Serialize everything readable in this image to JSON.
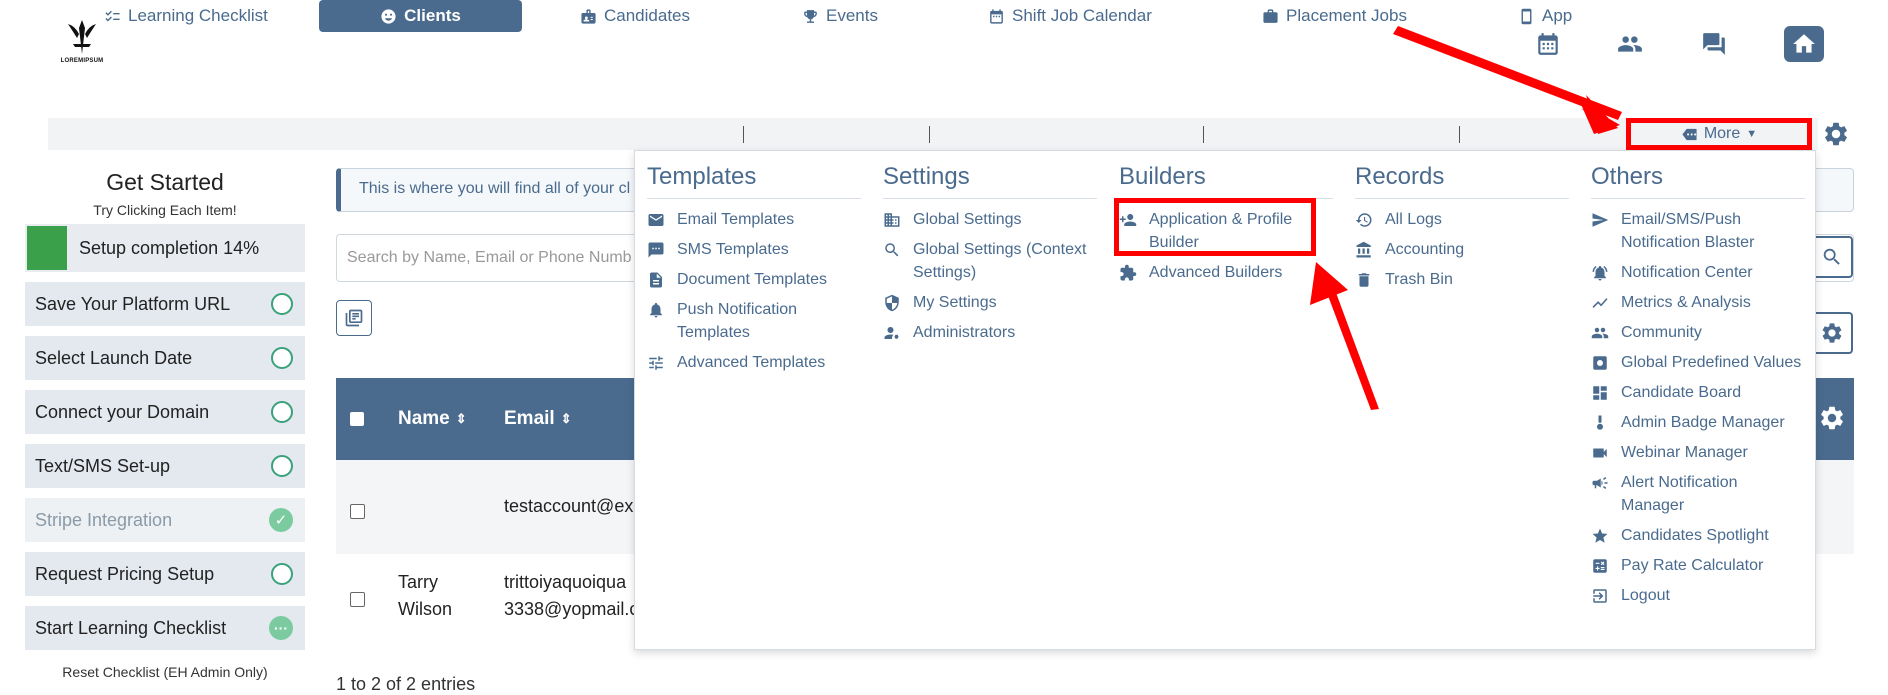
{
  "logo": {
    "text": "LOREMIPSUM"
  },
  "header_icons": [
    "calendar-icon",
    "people-icon",
    "chat-icon",
    "home-icon"
  ],
  "nav": {
    "items": [
      {
        "label": "Learning Checklist",
        "icon": "checklist-icon"
      },
      {
        "label": "Clients",
        "icon": "smile-icon",
        "active": true
      },
      {
        "label": "Candidates",
        "icon": "id-card-icon"
      },
      {
        "label": "Events",
        "icon": "trophy-icon"
      },
      {
        "label": "Shift Job Calendar",
        "icon": "calendar-icon"
      },
      {
        "label": "Placement Jobs",
        "icon": "briefcase-icon"
      },
      {
        "label": "App",
        "icon": "phone-icon"
      }
    ],
    "more_label": "More"
  },
  "checklist": {
    "title": "Get Started",
    "subtitle": "Try Clicking Each Item!",
    "progress_label": "Setup completion 14%",
    "progress_percent": 14,
    "items": [
      {
        "label": "Save Your Platform URL",
        "state": "open"
      },
      {
        "label": "Select Launch Date",
        "state": "open"
      },
      {
        "label": "Connect your Domain",
        "state": "open"
      },
      {
        "label": "Text/SMS Set-up",
        "state": "open"
      },
      {
        "label": "Stripe Integration",
        "state": "done"
      },
      {
        "label": "Request Pricing Setup",
        "state": "open"
      },
      {
        "label": "Start Learning Checklist",
        "state": "in-progress"
      }
    ],
    "reset_label": "Reset Checklist (EH Admin Only)"
  },
  "main": {
    "info_text": "This is where you will find all of your cl",
    "search_placeholder": "Search by Name, Email or Phone Numb",
    "columns": [
      "Name",
      "Email"
    ],
    "rows": [
      {
        "name": "",
        "email": "testaccount@ex"
      },
      {
        "name_line1": "Tarry",
        "name_line2": "Wilson",
        "email_line1": "trittoiyaquoiqua",
        "email_line2": "3338@yopmail.c"
      }
    ],
    "entries_text": "1 to 2 of 2 entries"
  },
  "dropdown": {
    "templates": {
      "heading": "Templates",
      "items": [
        "Email Templates",
        "SMS Templates",
        "Document Templates",
        "Push Notification Templates",
        "Advanced Templates"
      ]
    },
    "settings": {
      "heading": "Settings",
      "items": [
        "Global Settings",
        "Global Settings (Context Settings)",
        "My Settings",
        "Administrators"
      ]
    },
    "builders": {
      "heading": "Builders",
      "items": [
        "Application & Profile Builder",
        "Advanced Builders"
      ]
    },
    "records": {
      "heading": "Records",
      "items": [
        "All Logs",
        "Accounting",
        "Trash Bin"
      ]
    },
    "others": {
      "heading": "Others",
      "items": [
        "Email/SMS/Push Notification Blaster",
        "Notification Center",
        "Metrics & Analysis",
        "Community",
        "Global Predefined Values",
        "Candidate Board",
        "Admin Badge Manager",
        "Webinar Manager",
        "Alert Notification Manager",
        "Candidates Spotlight",
        "Pay Rate Calculator",
        "Logout"
      ]
    }
  },
  "colors": {
    "accent": "#4a6b8e",
    "highlight": "#ff0000",
    "success": "#3aa14a"
  }
}
